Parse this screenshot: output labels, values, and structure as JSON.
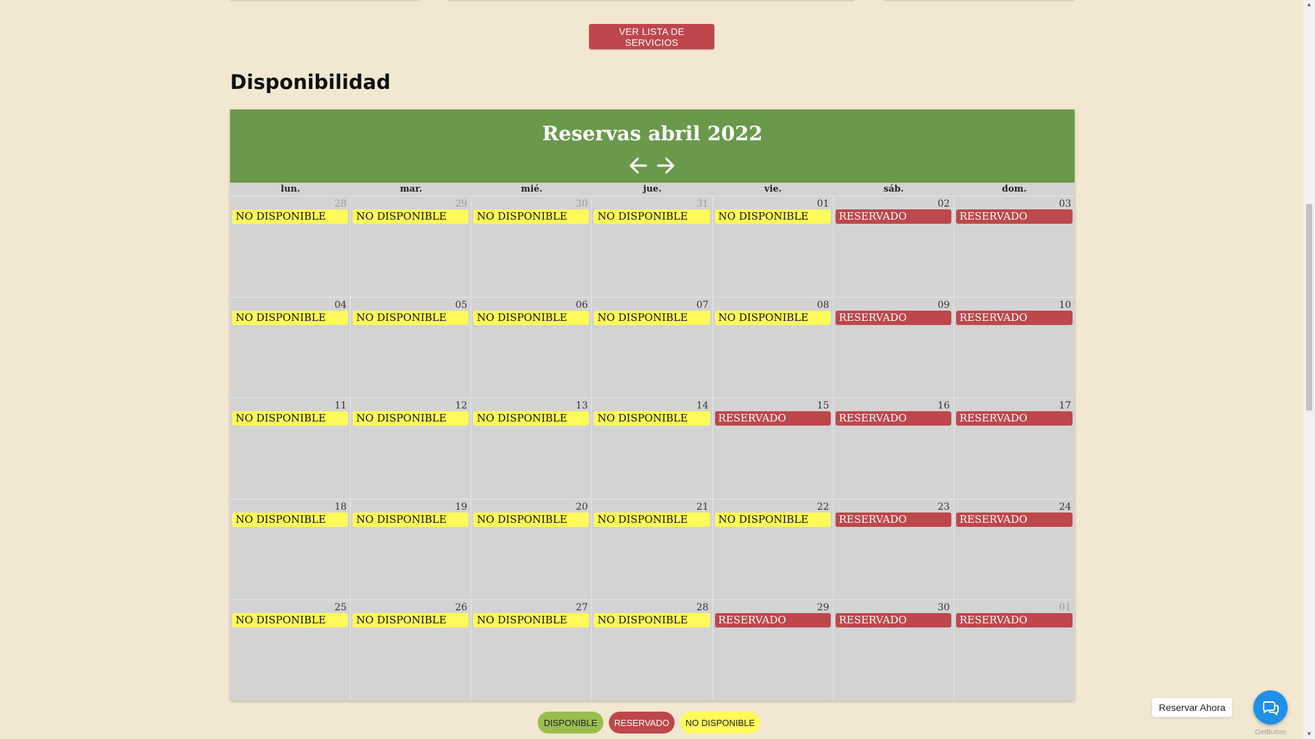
{
  "services_button": "VER LISTA DE SERVICIOS",
  "section_title": "Disponibilidad",
  "calendar": {
    "title": "Reservas abril 2022",
    "prev_icon": "arrow-left-icon",
    "next_icon": "arrow-right-icon",
    "weekdays": [
      "lun.",
      "mar.",
      "mié.",
      "jue.",
      "vie.",
      "sáb.",
      "dom."
    ],
    "weeks": [
      [
        {
          "day": "28",
          "status": "NO DISPONIBLE",
          "other_month": true
        },
        {
          "day": "29",
          "status": "NO DISPONIBLE",
          "other_month": true
        },
        {
          "day": "30",
          "status": "NO DISPONIBLE",
          "other_month": true
        },
        {
          "day": "31",
          "status": "NO DISPONIBLE",
          "other_month": true
        },
        {
          "day": "01",
          "status": "NO DISPONIBLE",
          "other_month": false
        },
        {
          "day": "02",
          "status": "RESERVADO",
          "other_month": false
        },
        {
          "day": "03",
          "status": "RESERVADO",
          "other_month": false
        }
      ],
      [
        {
          "day": "04",
          "status": "NO DISPONIBLE",
          "other_month": false
        },
        {
          "day": "05",
          "status": "NO DISPONIBLE",
          "other_month": false
        },
        {
          "day": "06",
          "status": "NO DISPONIBLE",
          "other_month": false
        },
        {
          "day": "07",
          "status": "NO DISPONIBLE",
          "other_month": false
        },
        {
          "day": "08",
          "status": "NO DISPONIBLE",
          "other_month": false
        },
        {
          "day": "09",
          "status": "RESERVADO",
          "other_month": false
        },
        {
          "day": "10",
          "status": "RESERVADO",
          "other_month": false
        }
      ],
      [
        {
          "day": "11",
          "status": "NO DISPONIBLE",
          "other_month": false
        },
        {
          "day": "12",
          "status": "NO DISPONIBLE",
          "other_month": false
        },
        {
          "day": "13",
          "status": "NO DISPONIBLE",
          "other_month": false
        },
        {
          "day": "14",
          "status": "NO DISPONIBLE",
          "other_month": false
        },
        {
          "day": "15",
          "status": "RESERVADO",
          "other_month": false
        },
        {
          "day": "16",
          "status": "RESERVADO",
          "other_month": false
        },
        {
          "day": "17",
          "status": "RESERVADO",
          "other_month": false
        }
      ],
      [
        {
          "day": "18",
          "status": "NO DISPONIBLE",
          "other_month": false
        },
        {
          "day": "19",
          "status": "NO DISPONIBLE",
          "other_month": false
        },
        {
          "day": "20",
          "status": "NO DISPONIBLE",
          "other_month": false
        },
        {
          "day": "21",
          "status": "NO DISPONIBLE",
          "other_month": false
        },
        {
          "day": "22",
          "status": "NO DISPONIBLE",
          "other_month": false
        },
        {
          "day": "23",
          "status": "RESERVADO",
          "other_month": false
        },
        {
          "day": "24",
          "status": "RESERVADO",
          "other_month": false
        }
      ],
      [
        {
          "day": "25",
          "status": "NO DISPONIBLE",
          "other_month": false
        },
        {
          "day": "26",
          "status": "NO DISPONIBLE",
          "other_month": false
        },
        {
          "day": "27",
          "status": "NO DISPONIBLE",
          "other_month": false
        },
        {
          "day": "28",
          "status": "NO DISPONIBLE",
          "other_month": false
        },
        {
          "day": "29",
          "status": "RESERVADO",
          "other_month": false
        },
        {
          "day": "30",
          "status": "RESERVADO",
          "other_month": false
        },
        {
          "day": "01",
          "status": "RESERVADO",
          "other_month": true
        }
      ]
    ]
  },
  "legend": {
    "available": "DISPONIBLE",
    "reserved": "RESERVADO",
    "unavailable": "NO DISPONIBLE"
  },
  "chat": {
    "label": "Reservar Ahora",
    "icon": "chat-bubbles-icon",
    "brand": "GetButton"
  },
  "colors": {
    "background": "#f2e8d2",
    "header_green": "#6a994b",
    "reserved_red": "#bd474b",
    "unavailable_yellow": "#fdfa59",
    "available_green": "#9bbd4e",
    "chat_blue": "#1e90e8"
  }
}
